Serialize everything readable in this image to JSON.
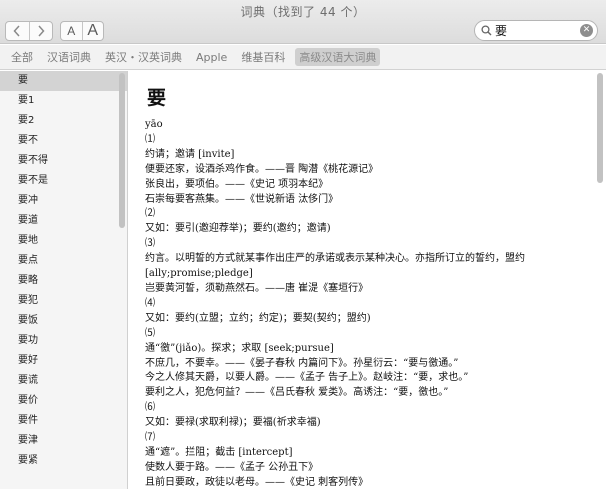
{
  "window": {
    "title": "词典（找到了 44 个）"
  },
  "toolbar": {
    "font_small_label": "A",
    "font_large_label": "A"
  },
  "search": {
    "value": "要"
  },
  "tabs": [
    {
      "label": "全部"
    },
    {
      "label": "汉语词典"
    },
    {
      "label": "英汉・汉英词典"
    },
    {
      "label": "Apple"
    },
    {
      "label": "维基百科"
    },
    {
      "label": "高级汉语大词典",
      "selected": true
    }
  ],
  "sidebar": {
    "items": [
      {
        "label": "要",
        "selected": true
      },
      {
        "label": "要1"
      },
      {
        "label": "要2"
      },
      {
        "label": "要不"
      },
      {
        "label": "要不得"
      },
      {
        "label": "要不是"
      },
      {
        "label": "要冲"
      },
      {
        "label": "要道"
      },
      {
        "label": "要地"
      },
      {
        "label": "要点"
      },
      {
        "label": "要略"
      },
      {
        "label": "要犯"
      },
      {
        "label": "要饭"
      },
      {
        "label": "要功"
      },
      {
        "label": "要好"
      },
      {
        "label": "要谎"
      },
      {
        "label": "要价"
      },
      {
        "label": "要件"
      },
      {
        "label": "要津"
      },
      {
        "label": "要紧"
      }
    ]
  },
  "entry": {
    "headword": "要",
    "lines": [
      "yāo",
      "⑴",
      "约请；邀请 [invite]",
      "便要还家，设酒杀鸡作食。——晋 陶潜《桃花源记》",
      "张良出，要项伯。——《史记 项羽本纪》",
      "石崇每要客燕集。——《世说新语 汰侈门》",
      "⑵",
      "又如：要引(邀迎荐举)；要约(邀约；邀请)",
      "⑶",
      "约言。以明誓的方式就某事作出庄严的承诺或表示某种决心。亦指所订立的誓约，盟约",
      "[ally;promise;pledge]",
      "岂要黄河誓，须勒燕然石。——唐 崔湜《塞垣行》",
      "⑷",
      "又如：要约(立盟；立约；约定)；要契(契约；盟约)",
      "⑸",
      "通“徼”(jiǎo)。探求；求取 [seek;pursue]",
      "不庶几，不要幸。——《晏子春秋 内篇问下》。孙星衍云：“要与徼通。”",
      "今之人修其天爵，以要人爵。——《孟子 告子上》。赵岐注：“要，求也。”",
      "要利之人，犯危何益？——《吕氏春秋 爱类》。高诱注：“要，徼也。”",
      "⑹",
      "又如：要禄(求取利禄)；要福(祈求幸福)",
      "⑺",
      "通“遮”。拦阻；截击 [intercept]",
      "使数人要于路。——《孟子 公孙丑下》",
      "且前日要政，政徒以老母。——《史记 刺客列传》"
    ]
  }
}
